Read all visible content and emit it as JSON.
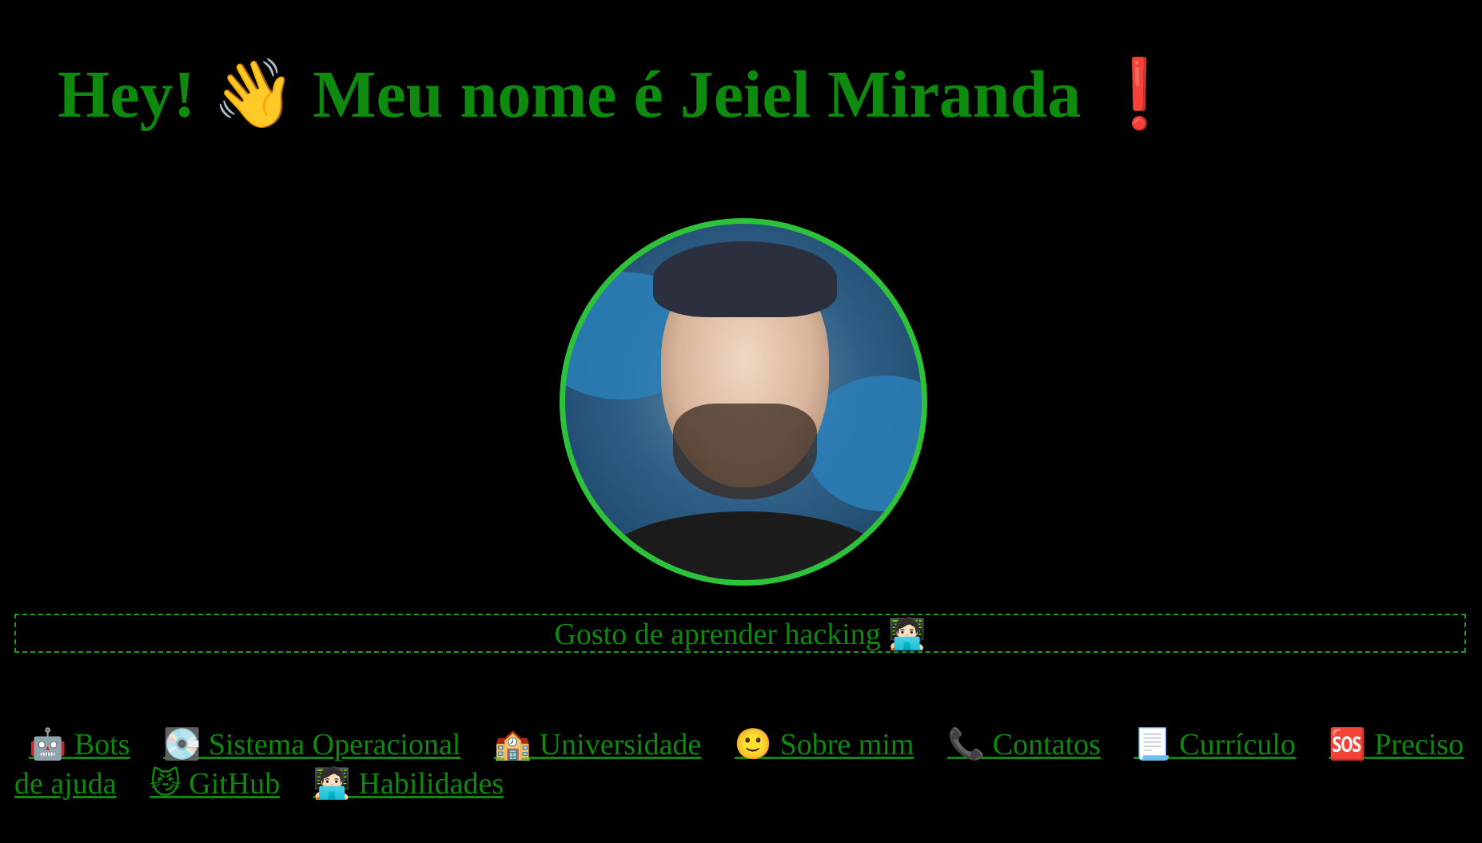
{
  "header": {
    "greeting": "Hey!",
    "wave_icon": "👋",
    "name_text": "Meu nome é Jeiel Miranda",
    "exclamation_icon": "❗"
  },
  "profile": {
    "photo_label": "avatar",
    "border_color": "#2ec13a"
  },
  "tagline": {
    "text": "Gosto de aprender hacking",
    "icon": "🧑🏻‍💻"
  },
  "nav": {
    "links": [
      {
        "icon": "🤖",
        "label": "Bots"
      },
      {
        "icon": "💽",
        "label": "Sistema Operacional"
      },
      {
        "icon": "🏫",
        "label": "Universidade"
      },
      {
        "icon": "🙂",
        "label": "Sobre mim"
      },
      {
        "icon": "📞",
        "label": "Contatos"
      },
      {
        "icon": "📃",
        "label": "Currículo"
      },
      {
        "icon": "🆘",
        "label": "Preciso de ajuda"
      },
      {
        "icon": "😼",
        "label": "GitHub"
      },
      {
        "icon": "🧑🏻‍💻",
        "label": "Habilidades"
      }
    ]
  },
  "colors": {
    "background": "#000000",
    "text_green": "#0e8a0e",
    "accent_green": "#2ec13a"
  }
}
